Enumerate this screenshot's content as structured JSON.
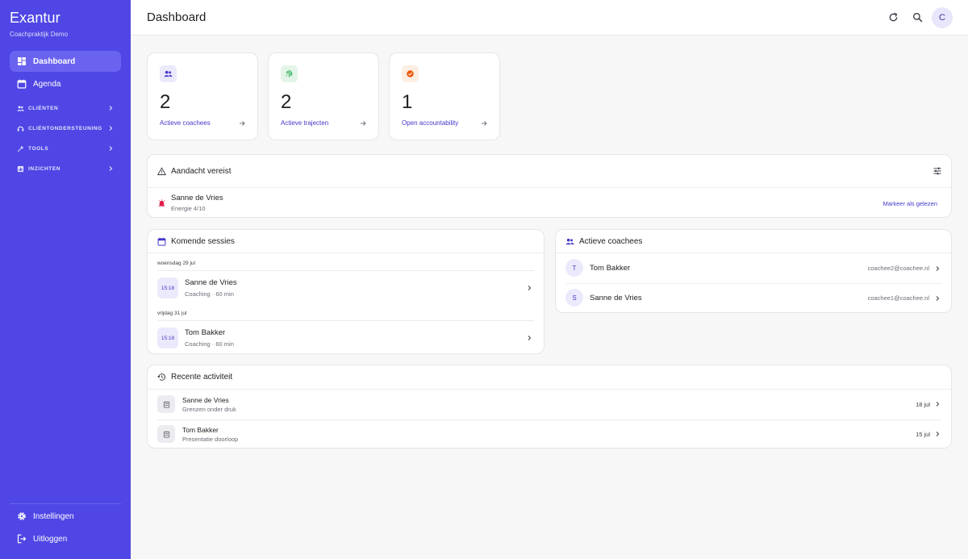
{
  "app": {
    "name": "Exantur",
    "subtitle": "Coachpraktijk Demo"
  },
  "colors": {
    "sidebar": "#4f46e5",
    "accent": "#4338ca",
    "alert": "#e11d48",
    "warning": "#ea580c",
    "success": "#16a34a"
  },
  "sidebar": {
    "items": [
      {
        "label": "Dashboard",
        "icon": "dashboard-icon",
        "active": true
      },
      {
        "label": "Agenda",
        "icon": "calendar-icon",
        "active": false
      }
    ],
    "sections": [
      {
        "label": "CLIËNTEN",
        "icon": "people-icon"
      },
      {
        "label": "CLIËNTONDERSTEUNING",
        "icon": "support-icon"
      },
      {
        "label": "TOOLS",
        "icon": "wrench-icon"
      },
      {
        "label": "INZICHTEN",
        "icon": "insights-icon"
      }
    ],
    "bottom": [
      {
        "label": "Instellingen",
        "icon": "gear-icon"
      },
      {
        "label": "Uitloggen",
        "icon": "logout-icon"
      }
    ]
  },
  "header": {
    "title": "Dashboard",
    "avatar_letter": "C",
    "icons": [
      "refresh-icon",
      "search-icon"
    ]
  },
  "stats": [
    {
      "value": "2",
      "label": "Actieve coachees",
      "icon": "people-icon"
    },
    {
      "value": "2",
      "label": "Actieve trajecten",
      "icon": "fingerprint-icon"
    },
    {
      "value": "1",
      "label": "Open accountability",
      "icon": "check-circle-icon"
    }
  ],
  "attention": {
    "title": "Aandacht vereist",
    "items": [
      {
        "name": "Sanne de Vries",
        "detail": "Energie 4/10",
        "action": "Markeer als gelezen"
      }
    ]
  },
  "sessions": {
    "title": "Komende sessies",
    "groups": [
      {
        "date": "woensdag 29 jul",
        "time": "15:18",
        "name": "Sanne de Vries",
        "detail": "Coaching · 60 min"
      },
      {
        "date": "vrijdag 31 jul",
        "time": "15:18",
        "name": "Tom Bakker",
        "detail": "Coaching · 60 min"
      }
    ]
  },
  "coachees": {
    "title": "Actieve coachees",
    "items": [
      {
        "initial": "T",
        "name": "Tom Bakker",
        "email": "coachee2@coachee.nl"
      },
      {
        "initial": "S",
        "name": "Sanne de Vries",
        "email": "coachee1@coachee.nl"
      }
    ]
  },
  "activity": {
    "title": "Recente activiteit",
    "items": [
      {
        "name": "Sanne de Vries",
        "detail": "Grenzen onder druk",
        "date": "18 jul"
      },
      {
        "name": "Tom Bakker",
        "detail": "Presentatie doorloop",
        "date": "15 jul"
      }
    ]
  }
}
